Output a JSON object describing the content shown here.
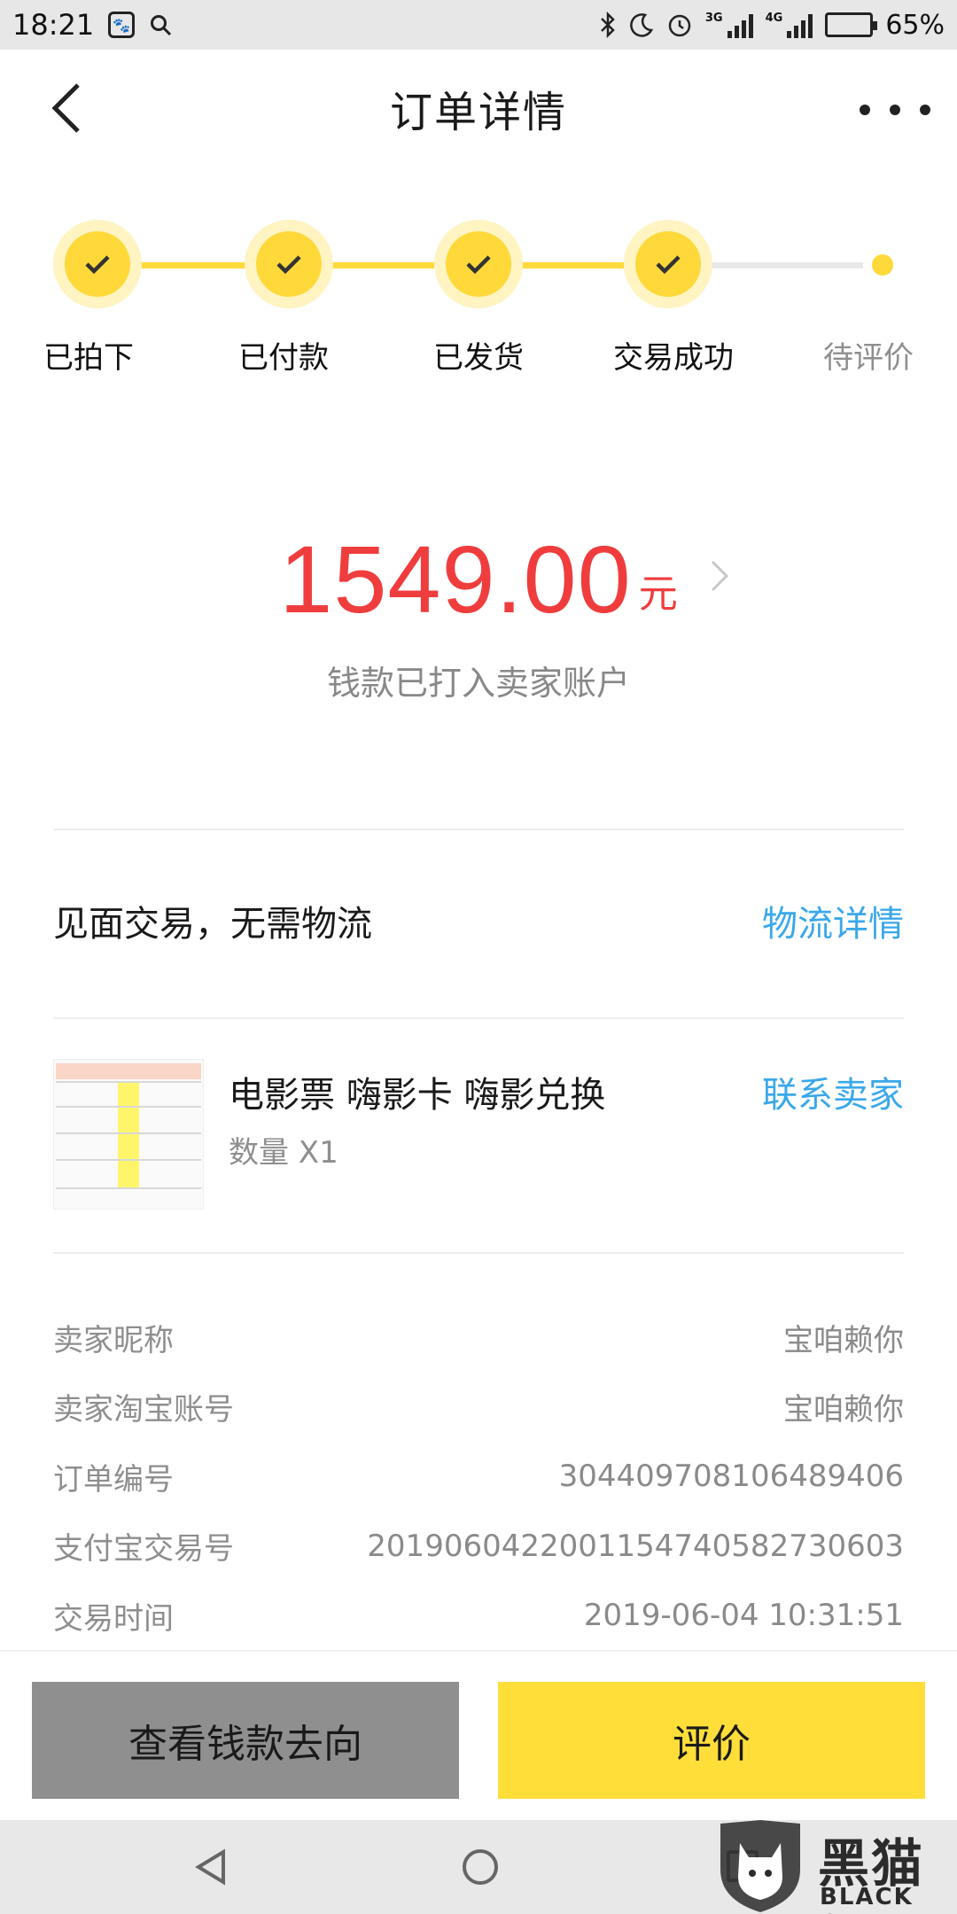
{
  "status_bar": {
    "time": "18:21",
    "network_3g": "3G",
    "network_4g": "4G",
    "battery_text": "65%",
    "battery_level": 0.65
  },
  "header": {
    "title": "订单详情"
  },
  "progress": {
    "steps": [
      {
        "label": "已拍下",
        "done": true
      },
      {
        "label": "已付款",
        "done": true
      },
      {
        "label": "已发货",
        "done": true
      },
      {
        "label": "交易成功",
        "done": true
      },
      {
        "label": "待评价",
        "done": false
      }
    ]
  },
  "payment": {
    "amount": "1549.00",
    "currency": "元",
    "status": "钱款已打入卖家账户"
  },
  "logistics": {
    "text": "见面交易，无需物流",
    "link": "物流详情"
  },
  "product": {
    "title": "电影票 嗨影卡 嗨影兑换",
    "quantity": "数量 X1",
    "contact": "联系卖家"
  },
  "order_info": [
    {
      "label": "卖家昵称",
      "value": "宝咱赖你"
    },
    {
      "label": "卖家淘宝账号",
      "value": "宝咱赖你"
    },
    {
      "label": "订单编号",
      "value": "304409708106489406"
    },
    {
      "label": "支付宝交易号",
      "value": "2019060422001154740582730603"
    },
    {
      "label": "交易时间",
      "value": "2019-06-04 10:31:51"
    }
  ],
  "actions": {
    "view_funds": "查看钱款去向",
    "review": "评价"
  },
  "watermark": {
    "title": "黑猫",
    "subtitle": "BLACK CAT"
  },
  "colors": {
    "accent_yellow": "#ffd93a",
    "amount_red": "#ef3d3d",
    "link_blue": "#3aa8ea"
  }
}
